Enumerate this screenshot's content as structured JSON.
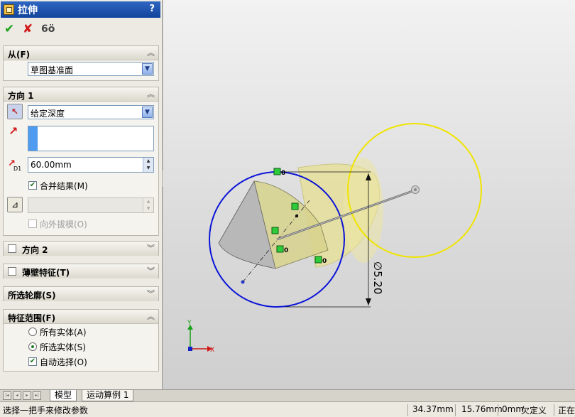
{
  "panel": {
    "title": "拉伸",
    "help": "?",
    "actions": {
      "ok": "✔",
      "cancel": "✘",
      "detail_preview": "6ö"
    }
  },
  "from_group": {
    "title": "从(F)",
    "start_condition": "草图基准面"
  },
  "direction1": {
    "title": "方向 1",
    "end_condition": "给定深度",
    "depth": "60.00mm",
    "depth_icon_label": "D1",
    "merge_result": {
      "label": "合并结果(M)",
      "checked": true
    },
    "draft_value": "",
    "draft_outward": {
      "label": "向外拔模(O)",
      "checked": false,
      "disabled": true
    }
  },
  "direction2": {
    "title": "方向 2",
    "checked": false
  },
  "thin_feature": {
    "title": "薄壁特征(T)",
    "checked": false
  },
  "selected_contours": {
    "title": "所选轮廓(S)"
  },
  "feature_scope": {
    "title": "特征范围(F)",
    "options": [
      {
        "label": "所有实体(A)",
        "selected": false
      },
      {
        "label": "所选实体(S)",
        "selected": true
      }
    ],
    "auto_select": {
      "label": "自动选择(O)",
      "checked": true
    }
  },
  "viewport": {
    "dimension_label": "∅5.20",
    "relation_tags": [
      "0",
      "0",
      "0"
    ],
    "triad": {
      "y": "Y",
      "x": "X"
    },
    "colors": {
      "sketch_circle": "#0a14d6",
      "preview_circle": "#f0e400",
      "extrude_preview": "#e9e3a0",
      "background": "#e2e2e2"
    }
  },
  "tabs": [
    "模型",
    "运动算例 1"
  ],
  "status": {
    "message": "选择一把手来修改参数",
    "x": "34.37mm",
    "y": "15.76mm",
    "z": "0mm",
    "state": "欠定义",
    "mode": "正在"
  }
}
